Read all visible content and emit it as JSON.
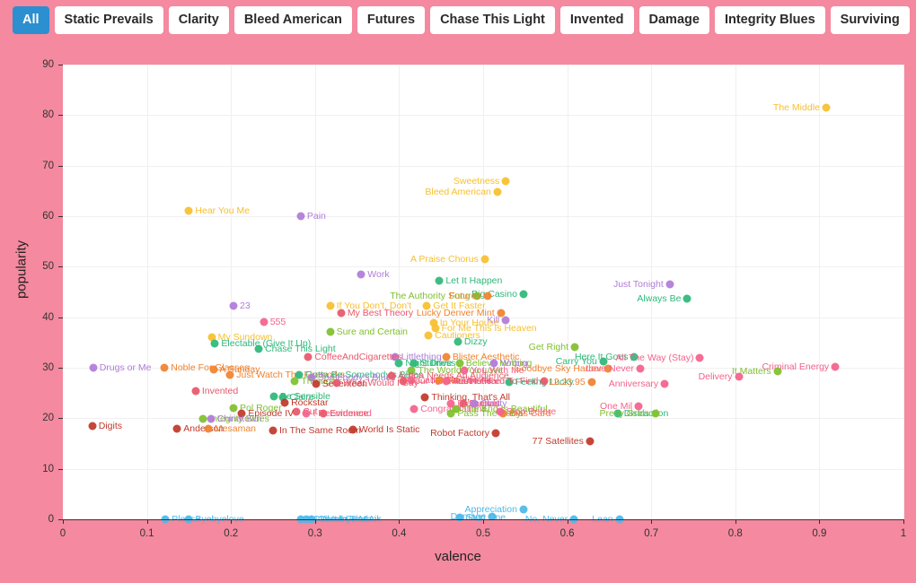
{
  "tabs": [
    {
      "label": "All",
      "active": true
    },
    {
      "label": "Static Prevails",
      "active": false
    },
    {
      "label": "Clarity",
      "active": false
    },
    {
      "label": "Bleed American",
      "active": false
    },
    {
      "label": "Futures",
      "active": false
    },
    {
      "label": "Chase This Light",
      "active": false
    },
    {
      "label": "Invented",
      "active": false
    },
    {
      "label": "Damage",
      "active": false
    },
    {
      "label": "Integrity Blues",
      "active": false
    },
    {
      "label": "Surviving",
      "active": false
    }
  ],
  "colors": {
    "page_background": "#f4899f",
    "plot_background": "#ffffff",
    "active_tab": "#2b8fd0",
    "tab_background": "#ffffff",
    "grid": "#f0f0f0",
    "axis": "#333333"
  },
  "chart_data": {
    "type": "scatter",
    "title": "",
    "xlabel": "valence",
    "ylabel": "popularity",
    "xlim": [
      0,
      1
    ],
    "ylim": [
      0,
      90
    ],
    "xticks": [
      "0",
      "0.1",
      "0.2",
      "0.3",
      "0.4",
      "0.5",
      "0.6",
      "0.7",
      "0.8",
      "0.9",
      "1"
    ],
    "yticks": [
      "0",
      "10",
      "20",
      "30",
      "40",
      "50",
      "60",
      "70",
      "80",
      "90"
    ],
    "grid": true,
    "legend": "none",
    "album_colors": {
      "Static Prevails": "#4db8e8",
      "Clarity": "#b07cd8",
      "Bleed American": "#f7bf2e",
      "Futures": "#f0822e",
      "Chase This Light": "#e8576b",
      "Invented": "#f4628c",
      "Damage": "#2eb87a",
      "Integrity Blues": "#7fbf2e",
      "Surviving": "#c0392b",
      "Other": "#ef5a5a"
    },
    "points": [
      {
        "label": "The Middle",
        "x": 0.908,
        "y": 81.5,
        "color": "#f7bf2e",
        "side": "l"
      },
      {
        "label": "Sweetness",
        "x": 0.527,
        "y": 67.0,
        "color": "#f7bf2e",
        "side": "l"
      },
      {
        "label": "Bleed American",
        "x": 0.517,
        "y": 64.8,
        "color": "#f7bf2e",
        "side": "l"
      },
      {
        "label": "Hear You Me",
        "x": 0.15,
        "y": 61.0,
        "color": "#f7bf2e",
        "side": "r"
      },
      {
        "label": "Pain",
        "x": 0.283,
        "y": 60.0,
        "color": "#b07cd8",
        "side": "r"
      },
      {
        "label": "A Praise Chorus",
        "x": 0.502,
        "y": 51.5,
        "color": "#f7bf2e",
        "side": "l"
      },
      {
        "label": "Work",
        "x": 0.355,
        "y": 48.5,
        "color": "#b07cd8",
        "side": "r"
      },
      {
        "label": "Let It Happen",
        "x": 0.448,
        "y": 47.3,
        "color": "#2eb87a",
        "side": "r"
      },
      {
        "label": "Just Tonight",
        "x": 0.722,
        "y": 46.5,
        "color": "#b07cd8",
        "side": "l"
      },
      {
        "label": "Big Casino",
        "x": 0.548,
        "y": 44.6,
        "color": "#2eb87a",
        "side": "l"
      },
      {
        "label": "Always Be",
        "x": 0.743,
        "y": 43.7,
        "color": "#2eb87a",
        "side": "l"
      },
      {
        "label": "The Authority Song",
        "x": 0.492,
        "y": 44.2,
        "color": "#7fbf2e",
        "side": "l"
      },
      {
        "label": "Futures",
        "x": 0.505,
        "y": 44.2,
        "color": "#f0822e",
        "side": "l"
      },
      {
        "label": "23",
        "x": 0.203,
        "y": 42.2,
        "color": "#b07cd8",
        "side": "r"
      },
      {
        "label": "If You Don't, Don't",
        "x": 0.318,
        "y": 42.3,
        "color": "#f7bf2e",
        "side": "r"
      },
      {
        "label": "Get It Faster",
        "x": 0.433,
        "y": 42.3,
        "color": "#f7bf2e",
        "side": "r"
      },
      {
        "label": "My Best Theory",
        "x": 0.331,
        "y": 40.9,
        "color": "#e8576b",
        "side": "r"
      },
      {
        "label": "Lucky Denver Mint",
        "x": 0.521,
        "y": 40.8,
        "color": "#f0822e",
        "side": "l"
      },
      {
        "label": "Kill",
        "x": 0.527,
        "y": 39.4,
        "color": "#b07cd8",
        "side": "l"
      },
      {
        "label": "555",
        "x": 0.239,
        "y": 39.0,
        "color": "#f4628c",
        "side": "r"
      },
      {
        "label": "In Your House",
        "x": 0.441,
        "y": 38.9,
        "color": "#f7bf2e",
        "side": "r"
      },
      {
        "label": "For Me This Is Heaven",
        "x": 0.443,
        "y": 37.8,
        "color": "#f7bf2e",
        "side": "r"
      },
      {
        "label": "Cautioners",
        "x": 0.435,
        "y": 36.4,
        "color": "#f7bf2e",
        "side": "r"
      },
      {
        "label": "Sure and Certain",
        "x": 0.318,
        "y": 37.1,
        "color": "#7fbf2e",
        "side": "r"
      },
      {
        "label": "My Sundown",
        "x": 0.177,
        "y": 36.1,
        "color": "#f7bf2e",
        "side": "r"
      },
      {
        "label": "Dizzy",
        "x": 0.47,
        "y": 35.2,
        "color": "#2eb87a",
        "side": "r"
      },
      {
        "label": "Electable (Give It Up)",
        "x": 0.181,
        "y": 34.8,
        "color": "#2eb87a",
        "side": "r"
      },
      {
        "label": "Chase This Light",
        "x": 0.233,
        "y": 33.8,
        "color": "#2eb87a",
        "side": "r"
      },
      {
        "label": "Get Right",
        "x": 0.609,
        "y": 34.0,
        "color": "#7fbf2e",
        "side": "l"
      },
      {
        "label": "Here It Goes",
        "x": 0.68,
        "y": 32.1,
        "color": "#2eb87a",
        "side": "l"
      },
      {
        "label": "All The Way (Stay)",
        "x": 0.758,
        "y": 32.0,
        "color": "#f4628c",
        "side": "l"
      },
      {
        "label": "Criminal Energy",
        "x": 0.919,
        "y": 30.2,
        "color": "#f4628c",
        "side": "l"
      },
      {
        "label": "It Matters",
        "x": 0.85,
        "y": 29.3,
        "color": "#7fbf2e",
        "side": "l"
      },
      {
        "label": "Delivery",
        "x": 0.804,
        "y": 28.3,
        "color": "#f4628c",
        "side": "l"
      },
      {
        "label": "Littlething",
        "x": 0.395,
        "y": 32.2,
        "color": "#b07cd8",
        "side": "r"
      },
      {
        "label": "Blister Aesthetic",
        "x": 0.456,
        "y": 32.2,
        "color": "#f0822e",
        "side": "r"
      },
      {
        "label": "CoffeeAndCigarettes",
        "x": 0.292,
        "y": 32.2,
        "color": "#e8576b",
        "side": "r"
      },
      {
        "label": "Believe Nothing",
        "x": 0.472,
        "y": 30.9,
        "color": "#7fbf2e",
        "side": "r"
      },
      {
        "label": "Wrong",
        "x": 0.513,
        "y": 30.9,
        "color": "#b07cd8",
        "side": "r"
      },
      {
        "label": "Night Drive",
        "x": 0.4,
        "y": 30.8,
        "color": "#2eb87a",
        "side": "r"
      },
      {
        "label": "Stillness",
        "x": 0.418,
        "y": 30.8,
        "color": "#2eb87a",
        "side": "r"
      },
      {
        "label": "Carry You",
        "x": 0.643,
        "y": 31.2,
        "color": "#2eb87a",
        "side": "l"
      },
      {
        "label": "Goodbye Sky Harbor",
        "x": 0.649,
        "y": 29.9,
        "color": "#f0822e",
        "side": "l"
      },
      {
        "label": "Love Never",
        "x": 0.687,
        "y": 29.8,
        "color": "#f4628c",
        "side": "l"
      },
      {
        "label": "The World You Love",
        "x": 0.415,
        "y": 29.5,
        "color": "#7fbf2e",
        "side": "r"
      },
      {
        "label": "You With Me",
        "x": 0.478,
        "y": 29.5,
        "color": "#f4628c",
        "side": "r"
      },
      {
        "label": "Drugs or Me",
        "x": 0.036,
        "y": 30.0,
        "color": "#b07cd8",
        "side": "r"
      },
      {
        "label": "Noble For Glasses",
        "x": 0.121,
        "y": 30.0,
        "color": "#f0822e",
        "side": "r"
      },
      {
        "label": "A Sunday",
        "x": 0.179,
        "y": 29.7,
        "color": "#f0822e",
        "side": "r"
      },
      {
        "label": "Just Watch The Fireworks",
        "x": 0.199,
        "y": 28.6,
        "color": "#f0822e",
        "side": "r"
      },
      {
        "label": "Gotta Be Somebody's Blues",
        "x": 0.281,
        "y": 28.6,
        "color": "#2eb87a",
        "side": "r"
      },
      {
        "label": "Somebody's Blues",
        "x": 0.296,
        "y": 28.0,
        "color": "#b07cd8",
        "side": "r"
      },
      {
        "label": "Action Needs An Audience",
        "x": 0.391,
        "y": 28.4,
        "color": "#e8576b",
        "side": "r"
      },
      {
        "label": "Your New Aesthetic",
        "x": 0.405,
        "y": 27.4,
        "color": "#e8576b",
        "side": "r"
      },
      {
        "label": "Caught In The Air",
        "x": 0.415,
        "y": 27.6,
        "color": "#f4628c",
        "side": "r"
      },
      {
        "label": "Ten",
        "x": 0.448,
        "y": 27.5,
        "color": "#f0822e",
        "side": "r"
      },
      {
        "label": "You're Free",
        "x": 0.456,
        "y": 27.3,
        "color": "#f4628c",
        "side": "r"
      },
      {
        "label": "Feeling Lucky",
        "x": 0.531,
        "y": 27.2,
        "color": "#2eb87a",
        "side": "r"
      },
      {
        "label": "Heart Is Hard To Find",
        "x": 0.573,
        "y": 27.4,
        "color": "#e8576b",
        "side": "l"
      },
      {
        "label": "12.23.95",
        "x": 0.629,
        "y": 27.1,
        "color": "#f0822e",
        "side": "l"
      },
      {
        "label": "Through",
        "x": 0.276,
        "y": 27.4,
        "color": "#7fbf2e",
        "side": "r"
      },
      {
        "label": "Seventeen",
        "x": 0.301,
        "y": 26.8,
        "color": "#c0392b",
        "side": "r"
      },
      {
        "label": "What Would I Say",
        "x": 0.326,
        "y": 26.9,
        "color": "#e8576b",
        "side": "r"
      },
      {
        "label": "Anniversary",
        "x": 0.716,
        "y": 26.8,
        "color": "#f4628c",
        "side": "l"
      },
      {
        "label": "Be Sensible",
        "x": 0.251,
        "y": 24.3,
        "color": "#2eb87a",
        "side": "r"
      },
      {
        "label": "Claire",
        "x": 0.262,
        "y": 24.2,
        "color": "#2eb87a",
        "side": "r"
      },
      {
        "label": "Rockstar",
        "x": 0.264,
        "y": 23.1,
        "color": "#c0392b",
        "side": "r"
      },
      {
        "label": "Thinking, That's All",
        "x": 0.431,
        "y": 24.2,
        "color": "#c0392b",
        "side": "r"
      },
      {
        "label": "Invented",
        "x": 0.158,
        "y": 25.3,
        "color": "#e8576b",
        "side": "r"
      },
      {
        "label": "Diamonds",
        "x": 0.462,
        "y": 22.9,
        "color": "#f4628c",
        "side": "r"
      },
      {
        "label": "Dugout",
        "x": 0.476,
        "y": 22.9,
        "color": "#e8576b",
        "side": "r"
      },
      {
        "label": "Clarity",
        "x": 0.489,
        "y": 22.9,
        "color": "#b07cd8",
        "side": "r"
      },
      {
        "label": "Congratulations",
        "x": 0.418,
        "y": 21.9,
        "color": "#f4628c",
        "side": "r"
      },
      {
        "label": "The End Is Beautiful",
        "x": 0.468,
        "y": 21.9,
        "color": "#7fbf2e",
        "side": "r"
      },
      {
        "label": "Pass The Baby",
        "x": 0.462,
        "y": 20.9,
        "color": "#7fbf2e",
        "side": "r"
      },
      {
        "label": "Bias Card",
        "x": 0.524,
        "y": 20.9,
        "color": "#f0822e",
        "side": "r"
      },
      {
        "label": "Distraction",
        "x": 0.66,
        "y": 20.9,
        "color": "#2eb87a",
        "side": "r"
      },
      {
        "label": "Pretty Grids",
        "x": 0.705,
        "y": 20.9,
        "color": "#7fbf2e",
        "side": "l"
      },
      {
        "label": "One Mil",
        "x": 0.685,
        "y": 22.4,
        "color": "#f4628c",
        "side": "l"
      },
      {
        "label": "Cut",
        "x": 0.278,
        "y": 21.3,
        "color": "#e8576b",
        "side": "r"
      },
      {
        "label": "Pol Roger",
        "x": 0.203,
        "y": 22.0,
        "color": "#7fbf2e",
        "side": "r"
      },
      {
        "label": "Episode IV",
        "x": 0.213,
        "y": 21.0,
        "color": "#c0392b",
        "side": "r"
      },
      {
        "label": "Integrity Blues",
        "x": 0.167,
        "y": 19.9,
        "color": "#7fbf2e",
        "side": "r"
      },
      {
        "label": "Chinatown",
        "x": 0.176,
        "y": 19.8,
        "color": "#b07cd8",
        "side": "r"
      },
      {
        "label": "Anderson",
        "x": 0.136,
        "y": 18.0,
        "color": "#c0392b",
        "side": "r"
      },
      {
        "label": "Mesaman",
        "x": 0.173,
        "y": 18.0,
        "color": "#f0822e",
        "side": "r"
      },
      {
        "label": "Digits",
        "x": 0.035,
        "y": 18.4,
        "color": "#c0392b",
        "side": "r"
      },
      {
        "label": "Stop Before",
        "x": 0.52,
        "y": 21.3,
        "color": "#f4628c",
        "side": "r"
      },
      {
        "label": "I Recommend",
        "x": 0.29,
        "y": 21.0,
        "color": "#f4628c",
        "side": "r"
      },
      {
        "label": "Evidence",
        "x": 0.31,
        "y": 20.9,
        "color": "#e8576b",
        "side": "r"
      },
      {
        "label": "In The Same Room",
        "x": 0.25,
        "y": 17.5,
        "color": "#c0392b",
        "side": "r"
      },
      {
        "label": "World Is Static",
        "x": 0.345,
        "y": 17.7,
        "color": "#c0392b",
        "side": "r"
      },
      {
        "label": "Robot Factory",
        "x": 0.515,
        "y": 17.0,
        "color": "#c0392b",
        "side": "l"
      },
      {
        "label": "77 Satellites",
        "x": 0.627,
        "y": 15.4,
        "color": "#c0392b",
        "side": "l"
      },
      {
        "label": "Appreciation",
        "x": 0.548,
        "y": 1.9,
        "color": "#4db8e8",
        "side": "l"
      },
      {
        "label": "Damage",
        "x": 0.511,
        "y": 0.6,
        "color": "#4db8e8",
        "side": "l"
      },
      {
        "label": "Step One",
        "x": 0.472,
        "y": 0.3,
        "color": "#4db8e8",
        "side": "r"
      },
      {
        "label": "Please",
        "x": 0.122,
        "y": 0.0,
        "color": "#4db8e8",
        "side": "r"
      },
      {
        "label": "Byebyelove",
        "x": 0.15,
        "y": 0.0,
        "color": "#4db8e8",
        "side": "r"
      },
      {
        "label": "No, Never",
        "x": 0.608,
        "y": 0.0,
        "color": "#4db8e8",
        "side": "l"
      },
      {
        "label": "Lean",
        "x": 0.662,
        "y": 0.0,
        "color": "#4db8e8",
        "side": "l"
      },
      {
        "label": "If I Were Good",
        "x": 0.283,
        "y": 0.0,
        "color": "#4db8e8",
        "side": "r"
      },
      {
        "label": "Goodbye Mack",
        "x": 0.296,
        "y": 0.0,
        "color": "#4db8e8",
        "side": "r"
      },
      {
        "label": "Call It In The Air",
        "x": 0.29,
        "y": 0.0,
        "color": "#4db8e8",
        "side": "r"
      }
    ]
  }
}
